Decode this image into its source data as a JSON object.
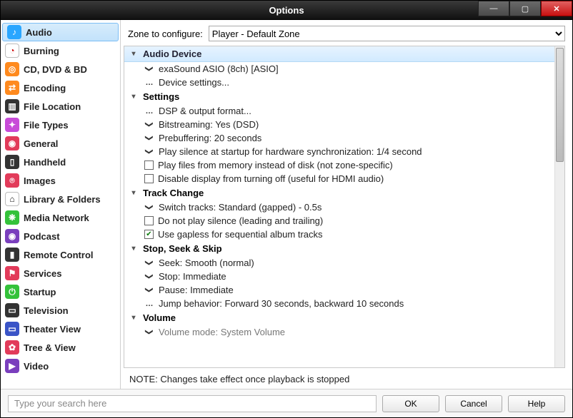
{
  "window": {
    "title": "Options"
  },
  "sidebar": {
    "items": [
      {
        "label": "Audio",
        "bg": "#2aa6ff",
        "glyph": "♪",
        "selected": true
      },
      {
        "label": "Burning",
        "bg": "#ffffff",
        "glyph": "◔",
        "fg": "#c00"
      },
      {
        "label": "CD, DVD & BD",
        "bg": "#ff8a1e",
        "glyph": "◎"
      },
      {
        "label": "Encoding",
        "bg": "#ff8a1e",
        "glyph": "⇄"
      },
      {
        "label": "File Location",
        "bg": "#333333",
        "glyph": "▥"
      },
      {
        "label": "File Types",
        "bg": "#c84bd8",
        "glyph": "✦"
      },
      {
        "label": "General",
        "bg": "#e23b5a",
        "glyph": "◉"
      },
      {
        "label": "Handheld",
        "bg": "#333333",
        "glyph": "▯"
      },
      {
        "label": "Images",
        "bg": "#e23b5a",
        "glyph": "⌾"
      },
      {
        "label": "Library & Folders",
        "bg": "#ffffff",
        "glyph": "⌂",
        "fg": "#111"
      },
      {
        "label": "Media Network",
        "bg": "#34c23a",
        "glyph": "❋"
      },
      {
        "label": "Podcast",
        "bg": "#7a3fbd",
        "glyph": "◉"
      },
      {
        "label": "Remote Control",
        "bg": "#333333",
        "glyph": "▮"
      },
      {
        "label": "Services",
        "bg": "#e23b5a",
        "glyph": "⚑"
      },
      {
        "label": "Startup",
        "bg": "#34c23a",
        "glyph": "⏻"
      },
      {
        "label": "Television",
        "bg": "#333333",
        "glyph": "▭"
      },
      {
        "label": "Theater View",
        "bg": "#3a54c7",
        "glyph": "▭"
      },
      {
        "label": "Tree & View",
        "bg": "#e23b5a",
        "glyph": "✿"
      },
      {
        "label": "Video",
        "bg": "#7a3fbd",
        "glyph": "▶"
      }
    ]
  },
  "zone": {
    "label": "Zone to configure:",
    "value": "Player - Default Zone"
  },
  "tree": {
    "sections": [
      {
        "title": "Audio Device",
        "first": true,
        "items": [
          {
            "kind": "chev",
            "text": "exaSound ASIO (8ch) [ASIO]"
          },
          {
            "kind": "dots",
            "text": "Device settings..."
          }
        ]
      },
      {
        "title": "Settings",
        "items": [
          {
            "kind": "dots",
            "text": "DSP & output format..."
          },
          {
            "kind": "chev",
            "text": "Bitstreaming: Yes (DSD)"
          },
          {
            "kind": "chev",
            "text": "Prebuffering: 20 seconds"
          },
          {
            "kind": "chev",
            "text": "Play silence at startup for hardware synchronization: 1/4 second"
          },
          {
            "kind": "check",
            "checked": false,
            "text": "Play files from memory instead of disk (not zone-specific)"
          },
          {
            "kind": "check",
            "checked": false,
            "text": "Disable display from turning off (useful for HDMI audio)"
          }
        ]
      },
      {
        "title": "Track Change",
        "items": [
          {
            "kind": "chev",
            "text": "Switch tracks: Standard (gapped) - 0.5s"
          },
          {
            "kind": "check",
            "checked": false,
            "text": "Do not play silence (leading and trailing)"
          },
          {
            "kind": "check",
            "checked": true,
            "text": "Use gapless for sequential album tracks"
          }
        ]
      },
      {
        "title": "Stop, Seek & Skip",
        "items": [
          {
            "kind": "chev",
            "text": "Seek: Smooth (normal)"
          },
          {
            "kind": "chev",
            "text": "Stop: Immediate"
          },
          {
            "kind": "chev",
            "text": "Pause: Immediate"
          },
          {
            "kind": "dots",
            "text": "Jump behavior: Forward 30 seconds, backward 10 seconds"
          }
        ]
      },
      {
        "title": "Volume",
        "items": [
          {
            "kind": "chev",
            "text": "Volume mode: System Volume",
            "dim": true
          }
        ]
      }
    ]
  },
  "note": "NOTE: Changes take effect once playback is stopped",
  "search": {
    "placeholder": "Type your search here"
  },
  "buttons": {
    "ok": "OK",
    "cancel": "Cancel",
    "help": "Help"
  }
}
